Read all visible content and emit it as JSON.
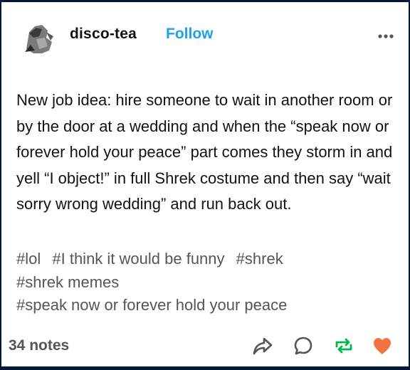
{
  "post": {
    "username": "disco-tea",
    "follow_label": "Follow",
    "more_icon": "more-dots-icon",
    "body": "New job idea: hire someone to wait in another room or by the door at a wedding and when the “speak now or forever hold your peace” part comes they storm in and yell “I object!” in full Shrek costume and then say “wait sorry wrong wedding” and run back out.",
    "tags": [
      "#lol",
      "#I think it would be funny",
      "#shrek",
      "#shrek memes",
      "#speak now or forever hold your peace"
    ],
    "notes": "34 notes",
    "actions": {
      "share_icon": "share-icon",
      "reply_icon": "reply-icon",
      "reblog_icon": "reblog-icon",
      "like_icon": "heart-icon"
    }
  },
  "colors": {
    "page_border": "#001935",
    "follow": "#1ea0ea",
    "reblog": "#00b74a",
    "like": "#f0743f",
    "text": "#121212",
    "muted": "#555555"
  }
}
